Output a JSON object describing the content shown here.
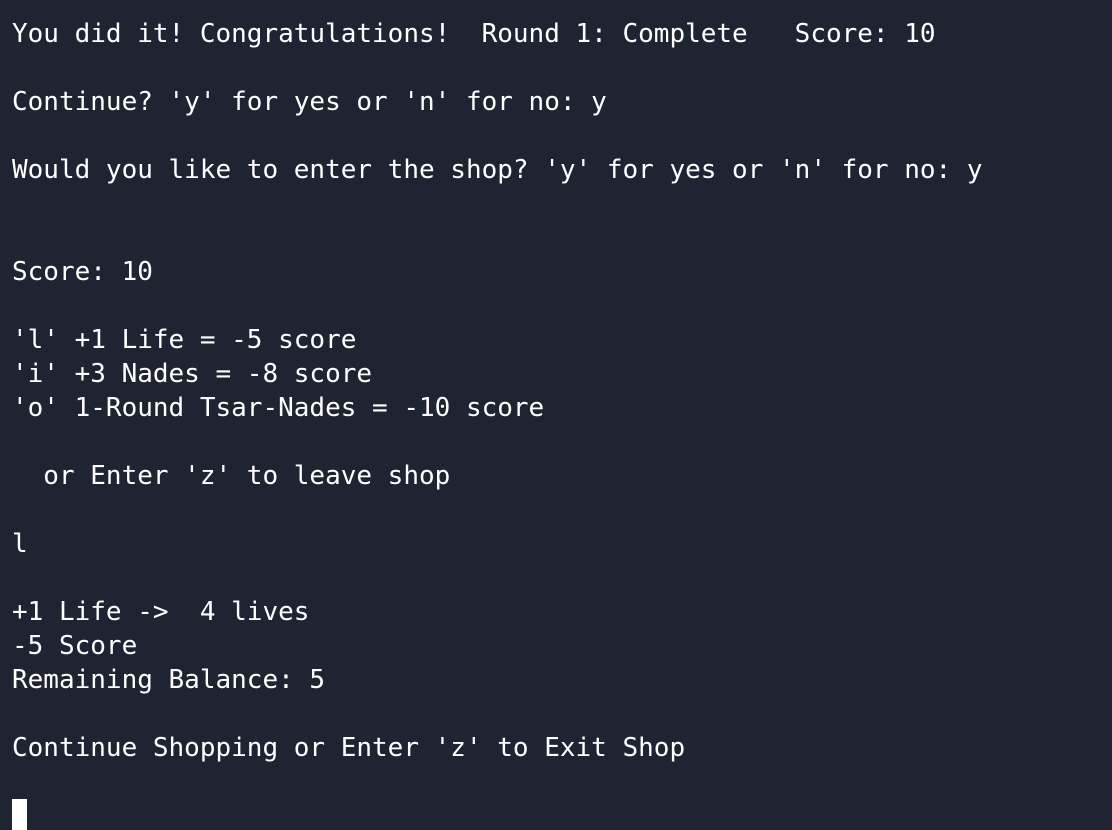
{
  "terminal": {
    "lines": [
      "You did it! Congratulations!  Round 1: Complete   Score: 10",
      "",
      "Continue? 'y' for yes or 'n' for no: y",
      "",
      "Would you like to enter the shop? 'y' for yes or 'n' for no: y",
      "",
      "",
      "Score: 10",
      "",
      "'l' +1 Life = -5 score",
      "'i' +3 Nades = -8 score",
      "'o' 1-Round Tsar-Nades = -10 score",
      "",
      "  or Enter 'z' to leave shop",
      "",
      "l",
      "",
      "+1 Life ->  4 lives",
      "-5 Score",
      "Remaining Balance: 5",
      "",
      "Continue Shopping or Enter 'z' to Exit Shop",
      ""
    ]
  }
}
